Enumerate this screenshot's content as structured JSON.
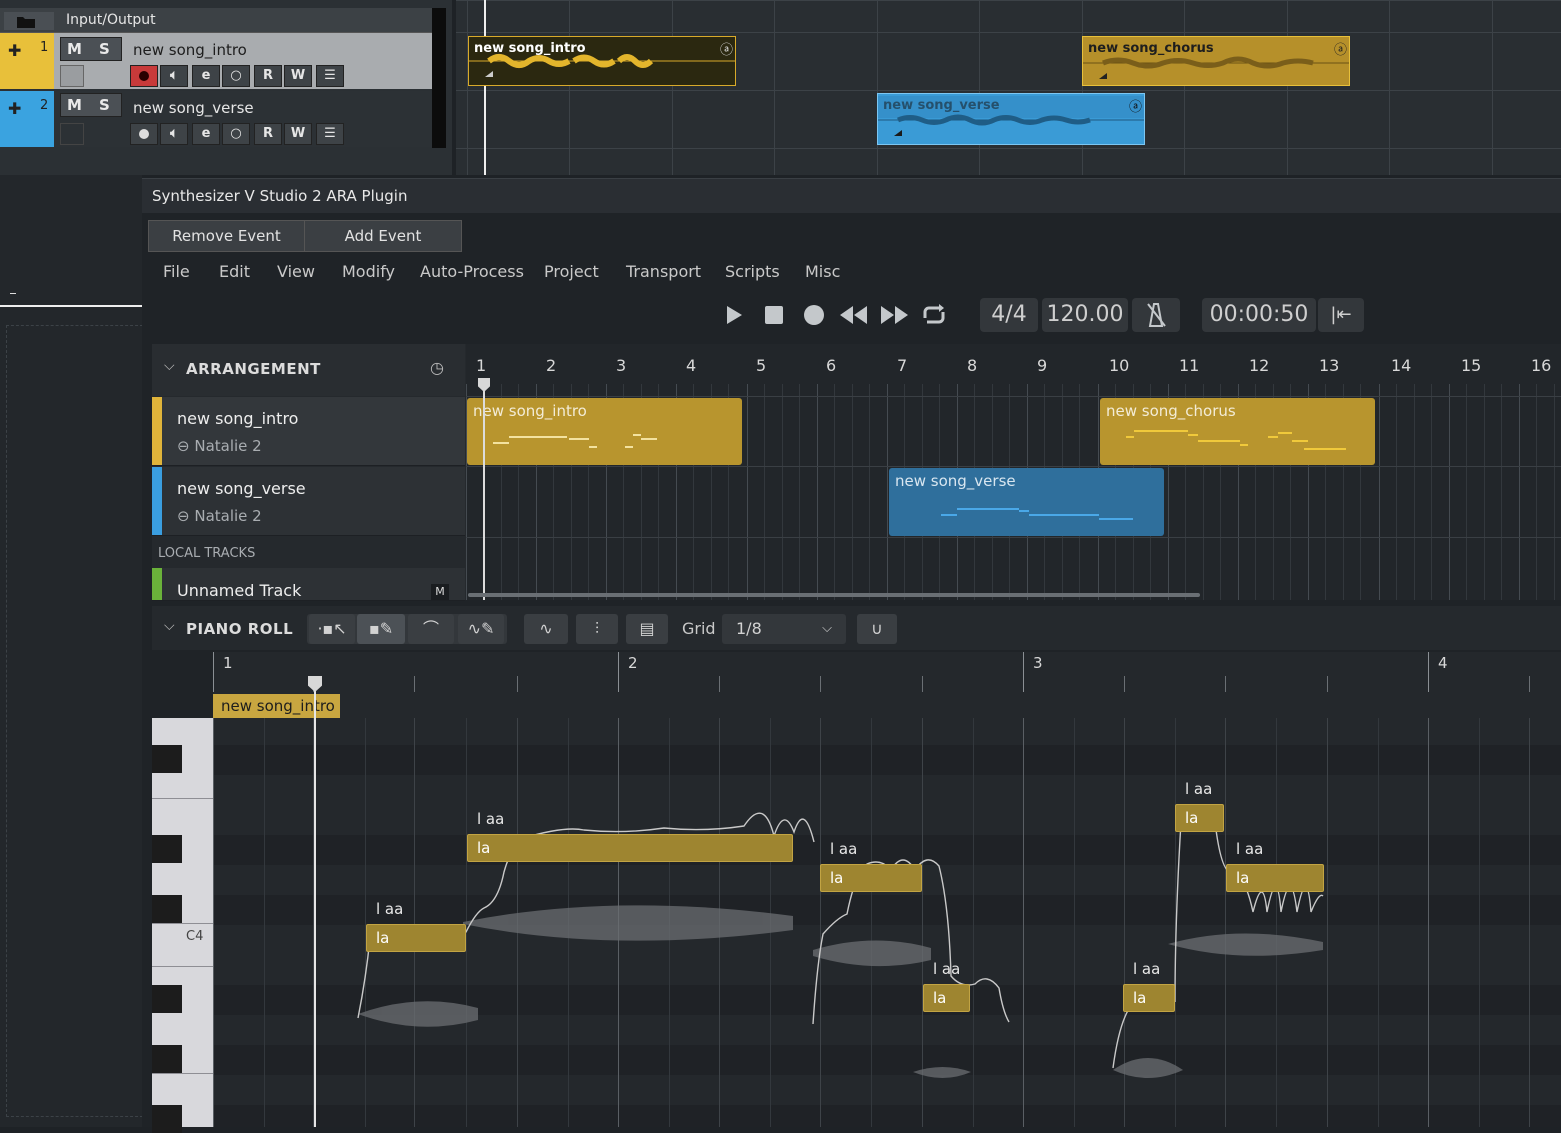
{
  "host": {
    "io_title": "Input/Output",
    "tracks": [
      {
        "num": "1",
        "name": "new song_intro",
        "color": "#e8c03a",
        "mute": "M",
        "solo": "S",
        "read": "R",
        "write": "W"
      },
      {
        "num": "2",
        "name": "new song_verse",
        "color": "#3aa3e0",
        "mute": "M",
        "solo": "S",
        "read": "R",
        "write": "W"
      }
    ],
    "clips": {
      "intro": "new song_intro",
      "chorus": "new song_chorus",
      "verse": "new song_verse"
    }
  },
  "plugin": {
    "title": "Synthesizer V Studio 2 ARA Plugin",
    "event_buttons": {
      "remove": "Remove Event",
      "add": "Add Event"
    },
    "menu": [
      "File",
      "Edit",
      "View",
      "Modify",
      "Auto-Process",
      "Project",
      "Transport",
      "Scripts",
      "Misc"
    ],
    "transport": {
      "time_signature": "4/4",
      "tempo": "120.00",
      "time": "00:00:50"
    },
    "arrangement": {
      "title": "ARRANGEMENT",
      "ruler": [
        "1",
        "2",
        "3",
        "4",
        "5",
        "6",
        "7",
        "8",
        "9",
        "10",
        "11",
        "12",
        "13",
        "14",
        "15",
        "16"
      ],
      "tracks": [
        {
          "name": "new song_intro",
          "voice": "Natalie 2",
          "color": "#e0b43a"
        },
        {
          "name": "new song_verse",
          "voice": "Natalie 2",
          "color": "#3a9ee0"
        }
      ],
      "local_tracks_label": "LOCAL TRACKS",
      "local_track": {
        "name": "Unnamed Track",
        "mute": "M",
        "color": "#6ab23a"
      },
      "clips": {
        "intro": "new song_intro",
        "chorus": "new song_chorus",
        "verse": "new song_verse"
      }
    },
    "piano_roll": {
      "title": "PIANO ROLL",
      "grid_label": "Grid",
      "grid_value": "1/8",
      "ruler": [
        "1",
        "2",
        "3",
        "4"
      ],
      "group_label": "new song_intro",
      "key_label": "C4",
      "notes": [
        {
          "lyric": "la",
          "phonemes": "l aa"
        },
        {
          "lyric": "la",
          "phonemes": "l aa"
        },
        {
          "lyric": "la",
          "phonemes": "l aa"
        },
        {
          "lyric": "la",
          "phonemes": "l aa"
        },
        {
          "lyric": "la",
          "phonemes": "l aa"
        },
        {
          "lyric": "la",
          "phonemes": "l aa"
        },
        {
          "lyric": "la",
          "phonemes": "l aa"
        }
      ]
    }
  }
}
